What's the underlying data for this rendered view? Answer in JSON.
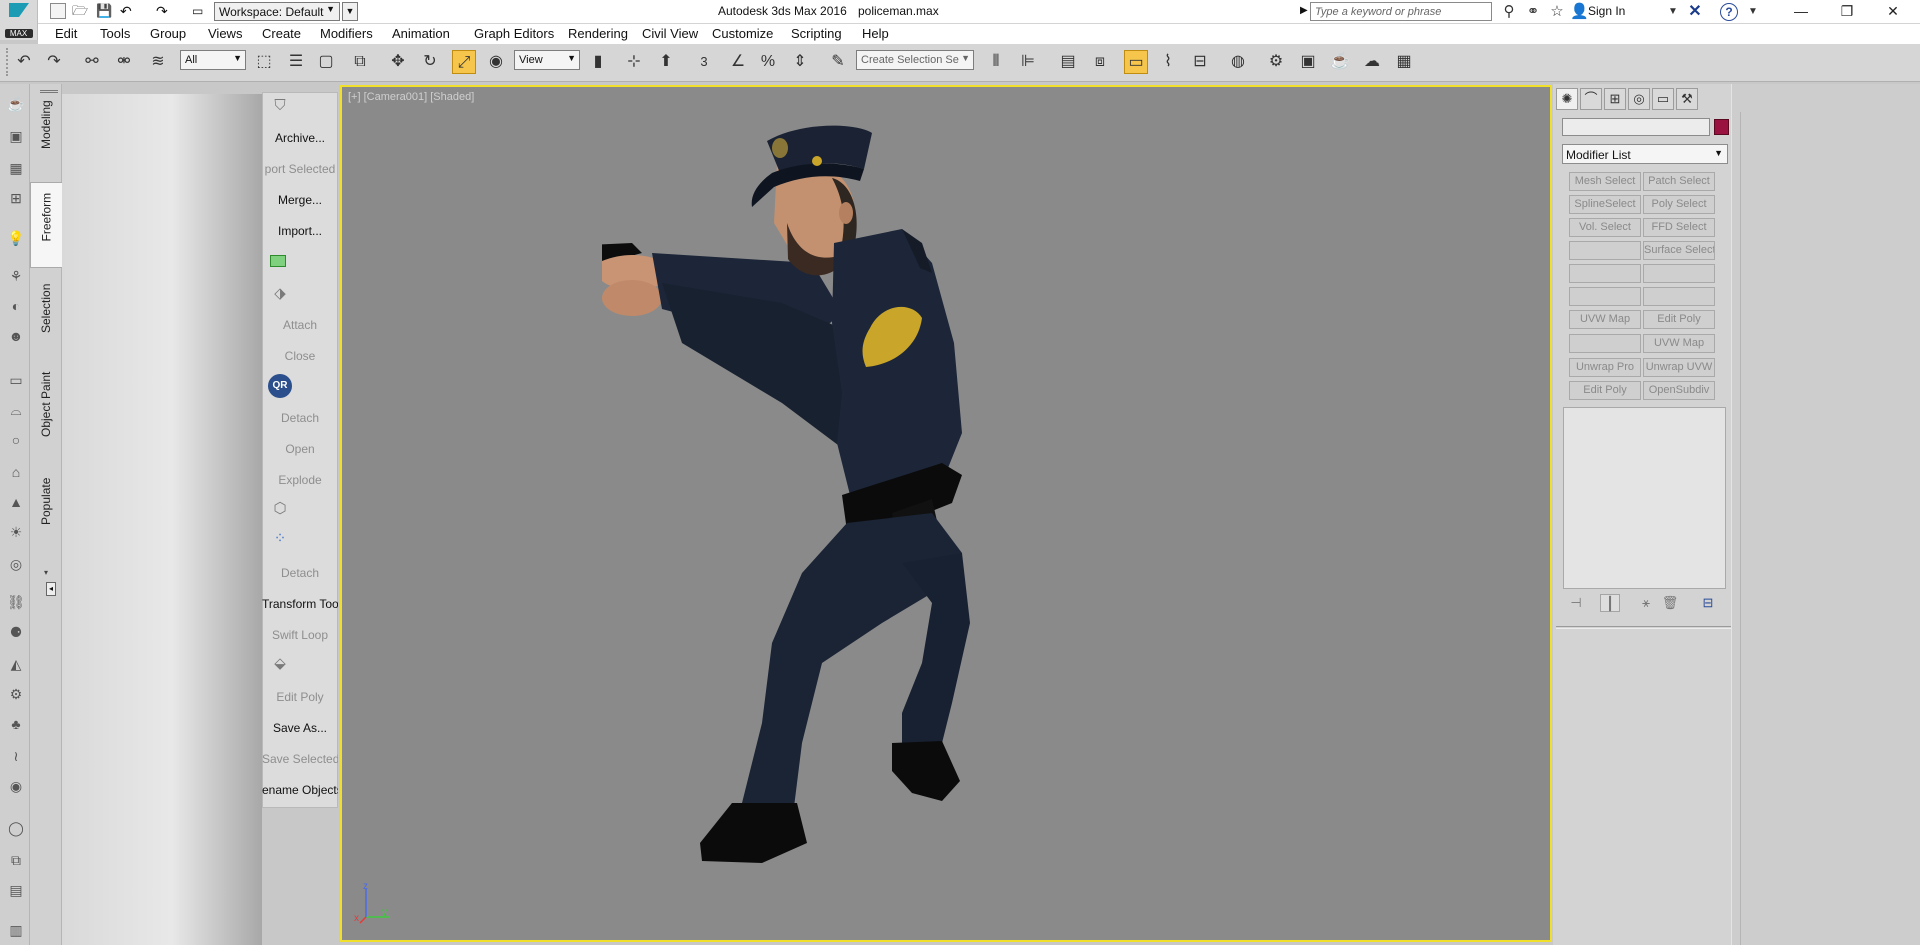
{
  "window": {
    "app_title": "Autodesk 3ds Max 2016",
    "file_title": "policeman.max",
    "logo_label": "MAX",
    "workspace_label": "Workspace: Default",
    "search_placeholder": "Type a keyword or phrase",
    "sign_in": "Sign In"
  },
  "menus": [
    "Edit",
    "Tools",
    "Group",
    "Views",
    "Create",
    "Modifiers",
    "Animation",
    "Graph Editors",
    "Rendering",
    "Civil View",
    "Customize",
    "Scripting",
    "Help"
  ],
  "toolbar": {
    "selection_filter": "All",
    "coord_system": "View",
    "snap_label": "3",
    "selection_set_placeholder": "Create Selection Se"
  },
  "ribbon_tabs": [
    "Modeling",
    "Freeform",
    "Selection",
    "Object Paint",
    "Populate"
  ],
  "tools_column": [
    {
      "label": "Archive...",
      "dim": false
    },
    {
      "label": "port Selected",
      "dim": true
    },
    {
      "label": "Merge...",
      "dim": false
    },
    {
      "label": "Import...",
      "dim": false
    },
    {
      "label": "Attach",
      "dim": true
    },
    {
      "label": "Close",
      "dim": true
    },
    {
      "label": "Detach",
      "dim": true
    },
    {
      "label": "Open",
      "dim": true
    },
    {
      "label": "Explode",
      "dim": true
    },
    {
      "label": "Detach",
      "dim": true
    },
    {
      "label": "Transform Tool",
      "dim": false
    },
    {
      "label": "Swift Loop",
      "dim": true
    },
    {
      "label": "Edit Poly",
      "dim": true
    },
    {
      "label": "Save As...",
      "dim": false
    },
    {
      "label": "Save Selected",
      "dim": true
    },
    {
      "label": "ename Objects",
      "dim": false
    }
  ],
  "qr_label": "QR",
  "viewport": {
    "label": "[+] [Camera001] [Shaded]",
    "axis_x": "x",
    "axis_y": "y",
    "axis_z": "z"
  },
  "command_panel": {
    "modifier_list": "Modifier List",
    "swatch_color": "#9a1240",
    "buttons": [
      [
        "Mesh Select",
        "Patch Select"
      ],
      [
        "SplineSelect",
        "Poly Select"
      ],
      [
        "Vol. Select",
        "FFD Select"
      ],
      [
        "",
        "Surface Select"
      ],
      [
        "",
        ""
      ],
      [
        "",
        ""
      ],
      [
        "UVW Map",
        "Edit Poly"
      ],
      [
        "",
        "UVW Map"
      ],
      [
        "Unwrap Pro",
        "Unwrap UVW"
      ],
      [
        "Edit Poly",
        "OpenSubdiv"
      ]
    ]
  },
  "colors": {
    "viewport_border": "#f0e02a",
    "active_tool": "#f5c64b",
    "uniform": "#1c2638",
    "badge": "#c9a52a"
  }
}
